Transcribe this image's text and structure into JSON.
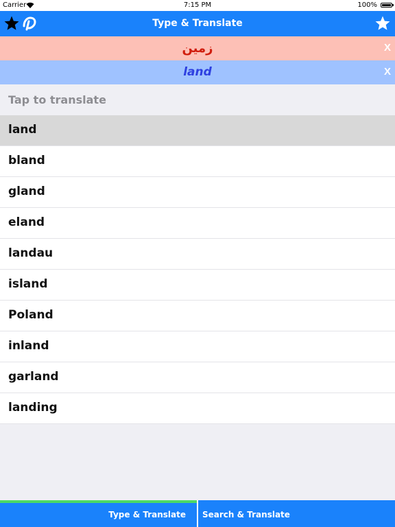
{
  "status_bar": {
    "carrier": "Carrier",
    "time": "7:15 PM",
    "battery": "100%"
  },
  "navbar": {
    "title": "Type & Translate",
    "left_icons": [
      "star-icon",
      "app-logo-icon"
    ],
    "right_icon": "star-icon"
  },
  "translation": {
    "arabic": "زمين",
    "english": "land",
    "close_label": "X"
  },
  "search": {
    "placeholder": "Tap to translate",
    "value": ""
  },
  "suggestions": [
    "land",
    "bland",
    "gland",
    "eland",
    "landau",
    "island",
    "Poland",
    "inland",
    "garland",
    "landing"
  ],
  "tabs": [
    {
      "label": "Type & Translate",
      "active": true
    },
    {
      "label": "Search & Translate",
      "active": false
    }
  ],
  "colors": {
    "accent": "#1a82fb",
    "arabic_bg": "#fdc0b6",
    "arabic_text": "#d01d0d",
    "english_bg": "#9fc2ff",
    "english_text": "#2e40e0",
    "active_tab_indicator": "#4cd964"
  }
}
